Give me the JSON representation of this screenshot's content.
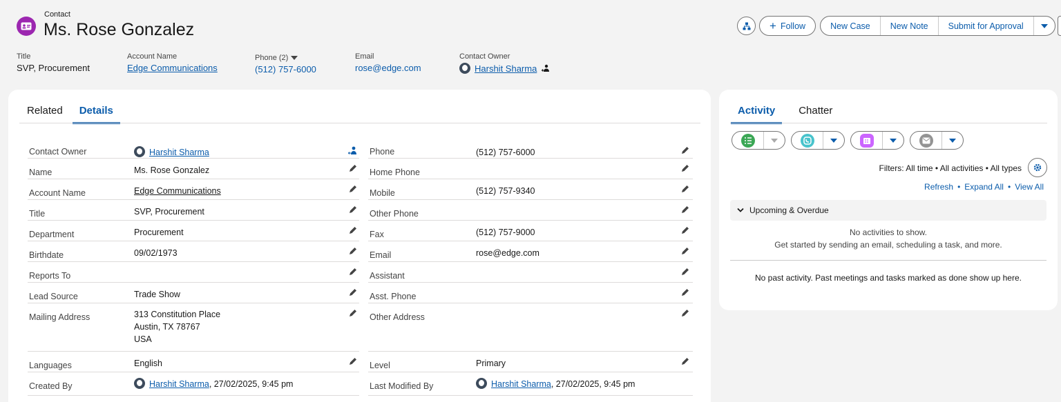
{
  "header": {
    "record_type": "Contact",
    "name": "Ms. Rose Gonzalez",
    "actions": {
      "follow": "Follow",
      "new_case": "New Case",
      "new_note": "New Note",
      "submit": "Submit for Approval"
    },
    "fields": [
      {
        "label": "Title",
        "value": "SVP, Procurement"
      },
      {
        "label": "Account Name",
        "value": "Edge Communications"
      },
      {
        "label": "Phone (2)",
        "value": "(512) 757-6000"
      },
      {
        "label": "Email",
        "value": "rose@edge.com"
      },
      {
        "label": "Contact Owner",
        "value": "Harshit Sharma"
      }
    ]
  },
  "main": {
    "tabs": [
      "Related",
      "Details"
    ],
    "left": [
      {
        "label": "Contact Owner",
        "value": "Harshit Sharma"
      },
      {
        "label": "Name",
        "value": "Ms. Rose Gonzalez"
      },
      {
        "label": "Account Name",
        "value": "Edge Communications"
      },
      {
        "label": "Title",
        "value": "SVP, Procurement"
      },
      {
        "label": "Department",
        "value": "Procurement"
      },
      {
        "label": "Birthdate",
        "value": "09/02/1973"
      },
      {
        "label": "Reports To",
        "value": ""
      },
      {
        "label": "Lead Source",
        "value": "Trade Show"
      },
      {
        "label": "Mailing Address",
        "line1": "313 Constitution Place",
        "line2": "Austin, TX 78767",
        "line3": "USA"
      },
      {
        "label": "Languages",
        "value": "English"
      },
      {
        "label": "Created By",
        "value": "Harshit Sharma",
        "suffix": ", 27/02/2025, 9:45 pm"
      }
    ],
    "right": [
      {
        "label": "Phone",
        "value": "(512) 757-6000"
      },
      {
        "label": "Home Phone",
        "value": ""
      },
      {
        "label": "Mobile",
        "value": "(512) 757-9340"
      },
      {
        "label": "Other Phone",
        "value": ""
      },
      {
        "label": "Fax",
        "value": "(512) 757-9000"
      },
      {
        "label": "Email",
        "value": "rose@edge.com"
      },
      {
        "label": "Assistant",
        "value": ""
      },
      {
        "label": "Asst. Phone",
        "value": ""
      },
      {
        "label": "Other Address",
        "value": ""
      },
      {
        "label": "Level",
        "value": "Primary"
      },
      {
        "label": "Last Modified By",
        "value": "Harshit Sharma",
        "suffix": ", 27/02/2025, 9:45 pm"
      }
    ]
  },
  "side": {
    "tabs": [
      "Activity",
      "Chatter"
    ],
    "filters": "Filters: All time • All activities • All types",
    "links": [
      "Refresh",
      "Expand All",
      "View All"
    ],
    "upcoming": "Upcoming & Overdue",
    "no_activities": "No activities to show.",
    "get_started": "Get started by sending an email, scheduling a task, and more.",
    "no_past": "No past activity. Past meetings and tasks marked as done show up here."
  },
  "colors": {
    "brand": "#0b5cab",
    "contact_icon": "#9c27b0",
    "task_icon": "#3ba755",
    "call_icon": "#48c3cc",
    "event_icon": "#cb65ff",
    "email_icon": "#939393"
  }
}
